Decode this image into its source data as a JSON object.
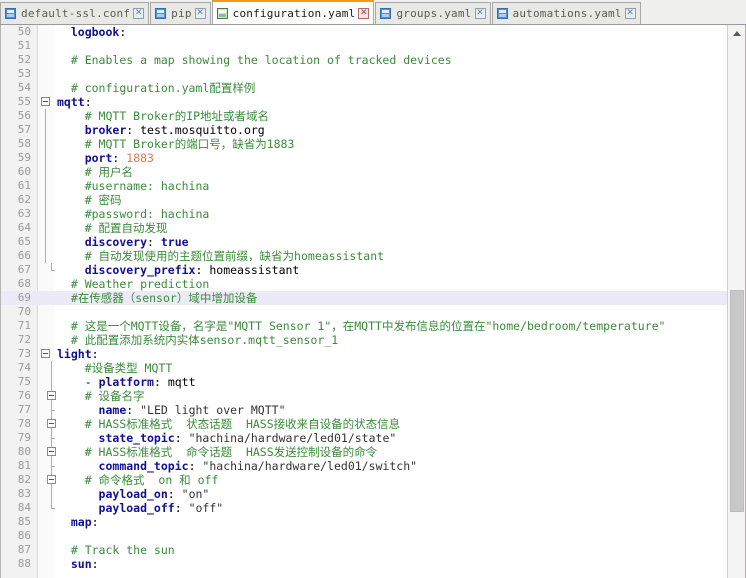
{
  "window": {
    "title": "configuration.yaml",
    "accent_color": "#f59b1c",
    "current_line_highlight": "#eceaf7"
  },
  "tabs": [
    {
      "label": "default-ssl.conf",
      "icon": "file-icon",
      "close_icon": "close-icon",
      "active": false
    },
    {
      "label": "pip",
      "icon": "file-icon",
      "close_icon": "close-icon",
      "active": false
    },
    {
      "label": "configuration.yaml",
      "icon": "file-icon",
      "close_icon": "close-icon",
      "active": true
    },
    {
      "label": "groups.yaml",
      "icon": "file-icon",
      "close_icon": "close-icon",
      "active": false
    },
    {
      "label": "automations.yaml",
      "icon": "file-icon",
      "close_icon": "close-icon",
      "active": false
    }
  ],
  "editor": {
    "first_line_number": 50,
    "current_line_number": 69,
    "lines": [
      {
        "n": 50,
        "text": "  logbook:"
      },
      {
        "n": 51,
        "text": ""
      },
      {
        "n": 52,
        "text": "  # Enables a map showing the location of tracked devices"
      },
      {
        "n": 53,
        "text": ""
      },
      {
        "n": 54,
        "text": "  # configuration.yaml配置样例"
      },
      {
        "n": 55,
        "text": "mqtt:"
      },
      {
        "n": 56,
        "text": "    # MQTT Broker的IP地址或者域名"
      },
      {
        "n": 57,
        "text": "    broker: test.mosquitto.org"
      },
      {
        "n": 58,
        "text": "    # MQTT Broker的端口号，缺省为1883"
      },
      {
        "n": 59,
        "text": "    port: 1883"
      },
      {
        "n": 60,
        "text": "    # 用户名"
      },
      {
        "n": 61,
        "text": "    #username: hachina"
      },
      {
        "n": 62,
        "text": "    # 密码"
      },
      {
        "n": 63,
        "text": "    #password: hachina"
      },
      {
        "n": 64,
        "text": "    # 配置自动发现"
      },
      {
        "n": 65,
        "text": "    discovery: true"
      },
      {
        "n": 66,
        "text": "    # 自动发现使用的主题位置前缀，缺省为homeassistant"
      },
      {
        "n": 67,
        "text": "    discovery_prefix: homeassistant"
      },
      {
        "n": 68,
        "text": "  # Weather prediction"
      },
      {
        "n": 69,
        "text": "  #在传感器（sensor）域中增加设备"
      },
      {
        "n": 70,
        "text": ""
      },
      {
        "n": 71,
        "text": "  # 这是一个MQTT设备，名字是\"MQTT Sensor 1\"，在MQTT中发布信息的位置在\"home/bedroom/temperature\""
      },
      {
        "n": 72,
        "text": "  # 此配置添加系统内实体sensor.mqtt_sensor_1"
      },
      {
        "n": 73,
        "text": "light:"
      },
      {
        "n": 74,
        "text": "    #设备类型 MQTT"
      },
      {
        "n": 75,
        "text": "    - platform: mqtt"
      },
      {
        "n": 76,
        "text": "    # 设备名字"
      },
      {
        "n": 77,
        "text": "      name: \"LED light over MQTT\""
      },
      {
        "n": 78,
        "text": "    # HASS标准格式  状态话题  HASS接收来自设备的状态信息"
      },
      {
        "n": 79,
        "text": "      state_topic: \"hachina/hardware/led01/state\""
      },
      {
        "n": 80,
        "text": "    # HASS标准格式  命令话题  HASS发送控制设备的命令"
      },
      {
        "n": 81,
        "text": "      command_topic: \"hachina/hardware/led01/switch\""
      },
      {
        "n": 82,
        "text": "    # 命令格式  on 和 off"
      },
      {
        "n": 83,
        "text": "      payload_on: \"on\""
      },
      {
        "n": 84,
        "text": "      payload_off: \"off\""
      },
      {
        "n": 85,
        "text": "  map:"
      },
      {
        "n": 86,
        "text": ""
      },
      {
        "n": 87,
        "text": "  # Track the sun"
      },
      {
        "n": 88,
        "text": "  sun:"
      }
    ]
  },
  "scrollbar": {
    "up_arrow": "chevron-up-icon",
    "down_arrow": "chevron-down-icon",
    "thumb_top_pct": 48,
    "thumb_height_pct": 40
  }
}
